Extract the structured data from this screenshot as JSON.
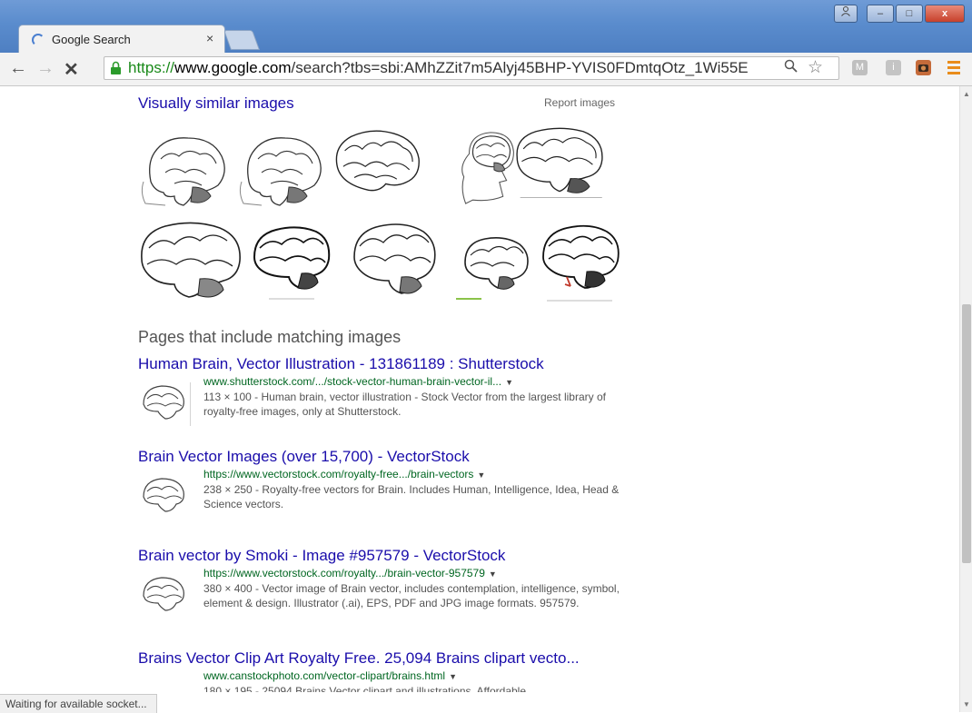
{
  "window": {
    "tab_title": "Google Search",
    "tab_close": "×",
    "buttons": {
      "minimize": "–",
      "maximize": "□",
      "close": "x"
    }
  },
  "toolbar": {
    "back": "←",
    "forward": "→",
    "stop": "✕",
    "url_scheme": "https://",
    "url_host": "www.google.com",
    "url_rest": "/search?tbs=sbi:AMhZZit7m5Alyj45BHP-YVIS0FDmtqOtz_1Wi55E",
    "extensions": [
      "M",
      "i"
    ]
  },
  "similar": {
    "title": "Visually similar images",
    "report": "Report images"
  },
  "pages": {
    "heading": "Pages that include matching images",
    "results": [
      {
        "title": "Human Brain, Vector Illustration - 131861189 : Shutterstock",
        "url": "www.shutterstock.com/.../stock-vector-human-brain-vector-il...",
        "snippet": "113 × 100 - Human brain, vector illustration - Stock Vector from the largest library of royalty-free images, only at Shutterstock."
      },
      {
        "title": "Brain Vector Images (over 15,700) - VectorStock",
        "url": "https://www.vectorstock.com/royalty-free.../brain-vectors",
        "snippet": "238 × 250 - Royalty-free vectors for Brain. Includes Human, Intelligence, Idea, Head & Science vectors."
      },
      {
        "title": "Brain vector by Smoki - Image #957579 - VectorStock",
        "url": "https://www.vectorstock.com/royalty.../brain-vector-957579",
        "snippet": "380 × 400 - Vector image of Brain vector, includes contemplation, intelligence, symbol, element & design. Illustrator (.ai), EPS, PDF and JPG image formats. 957579."
      },
      {
        "title": "Brains Vector Clip Art Royalty Free. 25,094 Brains clipart vecto...",
        "url": "www.canstockphoto.com/vector-clipart/brains.html",
        "snippet": "180 × 195 - 25094 Brains Vector clipart and illustrations. Affordable"
      }
    ]
  },
  "status": "Waiting for available socket..."
}
